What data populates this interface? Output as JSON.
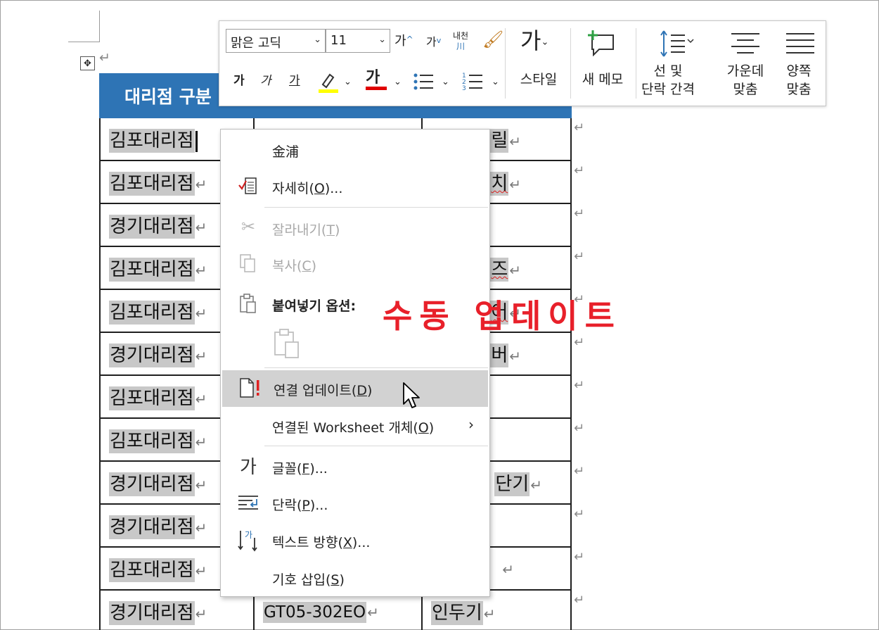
{
  "toolbar": {
    "font_name": "맑은 고딕",
    "font_size": "11",
    "grow_font": "가",
    "shrink_font": "가",
    "phonetic": "내천",
    "phonetic_sub": "川",
    "bold": "가",
    "italic": "가",
    "underline": "가",
    "font_color_glyph": "가",
    "styles_glyph": "가",
    "styles_label": "스타일",
    "new_comment_label": "새 메모",
    "line_spacing_label_1": "선  및",
    "line_spacing_label_2": "단락 간격",
    "center_label_1": "가운데",
    "center_label_2": "맞춤",
    "justify_label_1": "양쪽",
    "justify_label_2": "맞춤",
    "highlight_color": "#ffff00",
    "font_color": "#e00000"
  },
  "table": {
    "header_partial": "대리점 구분",
    "header_color": "#2e74b5",
    "rows": [
      {
        "c1": "김포대리점",
        "c3": "릴"
      },
      {
        "c1": "김포대리점",
        "c3": "치"
      },
      {
        "c1": "경기대리점",
        "c3": ""
      },
      {
        "c1": "김포대리점",
        "c3": "즈"
      },
      {
        "c1": "김포대리점",
        "c3": "어"
      },
      {
        "c1": "경기대리점",
        "c3": "버"
      },
      {
        "c1": "김포대리점",
        "c3": ""
      },
      {
        "c1": "김포대리점",
        "c3": ""
      },
      {
        "c1": "경기대리점",
        "c3": "단기"
      },
      {
        "c1": "경기대리점",
        "c3": ""
      },
      {
        "c1": "김포대리점",
        "c3": ""
      },
      {
        "c1": "경기대리점",
        "c2": "GT05-302EO",
        "c3": "인두기"
      }
    ]
  },
  "context_menu": {
    "hanja": "金浦",
    "details": "자세히(",
    "details_key": "O",
    "details_end": ")...",
    "cut": "잘라내기(",
    "cut_key": "T",
    "cut_end": ")",
    "copy": "복사(",
    "copy_key": "C",
    "copy_end": ")",
    "paste_options": "붙여넣기 옵션:",
    "update_link": "연결 업데이트(",
    "update_link_key": "D",
    "update_link_end": ")",
    "linked_worksheet": "연결된 Worksheet 개체(",
    "linked_worksheet_key": "O",
    "linked_worksheet_end": ")",
    "font": "글꼴(",
    "font_key": "F",
    "font_end": ")...",
    "paragraph": "단락(",
    "paragraph_key": "P",
    "paragraph_end": ")...",
    "text_direction": "텍스트 방향(",
    "text_direction_key": "X",
    "text_direction_end": ")...",
    "insert_symbol": "기호 삽입(",
    "insert_symbol_key": "S",
    "insert_symbol_end": ")"
  },
  "annotation": "수동 업데이트",
  "annotation_color": "#e8202a",
  "icons": {
    "move_handle": "move-icon",
    "paragraph_mark": "↵"
  }
}
